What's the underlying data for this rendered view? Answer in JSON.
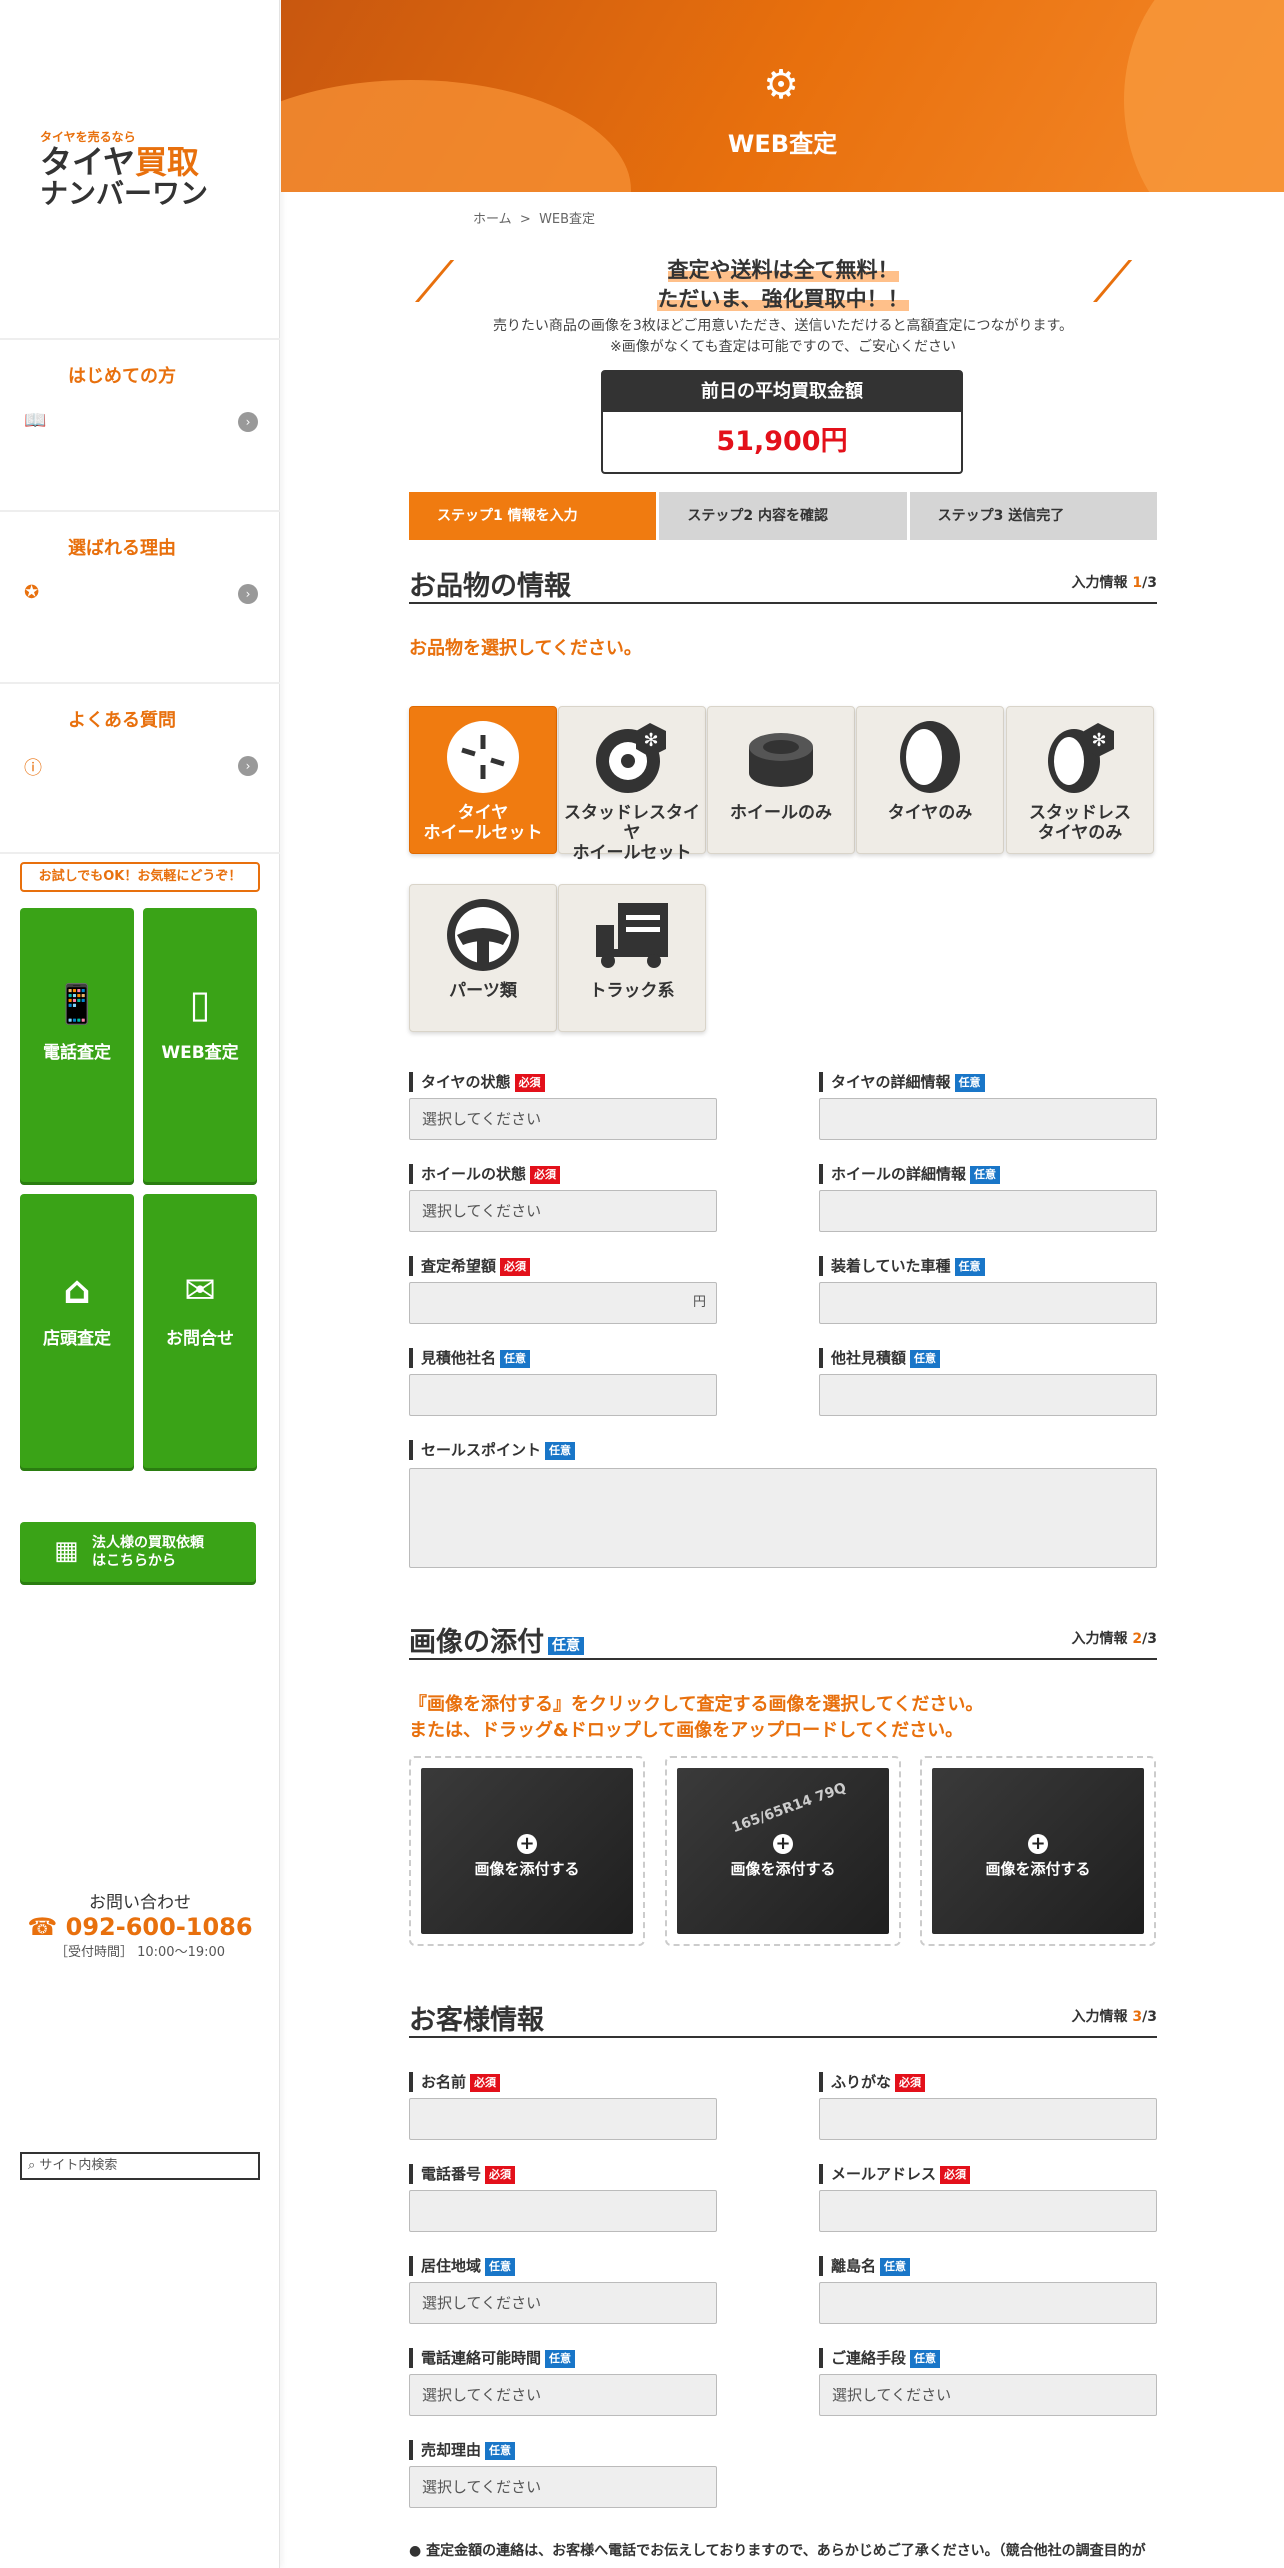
{
  "sidebar": {
    "logo": {
      "tagline": "タイヤを売るなら",
      "line1a": "タイヤ",
      "line1b": "買取",
      "line2": "ナンバーワン"
    },
    "nav": [
      {
        "label": "はじめての方",
        "icon": "book-icon"
      },
      {
        "label": "選ばれる理由",
        "icon": "badge-icon"
      },
      {
        "label": "よくある質問",
        "icon": "question-icon"
      }
    ],
    "speech": "お試しでもOK！お気軽にどうぞ！",
    "buttons": [
      {
        "label": "電話査定",
        "icon": "phone-icon"
      },
      {
        "label": "WEB査定",
        "icon": "tablet-icon"
      },
      {
        "label": "店頭査定",
        "icon": "store-icon"
      },
      {
        "label": "お問合せ",
        "icon": "mail-icon"
      }
    ],
    "corporate": {
      "line1": "法人様の買取依頼",
      "line2": "はこちらから"
    },
    "contact": {
      "label": "お問い合わせ",
      "phone": "☎ 092-600-1086",
      "hours": "［受付時間］ 10:00〜19:00"
    },
    "search_placeholder": "サイト内検索"
  },
  "hero": {
    "title": "WEB査定"
  },
  "breadcrumb": {
    "home": "ホーム",
    "sep": ">",
    "current": "WEB査定"
  },
  "promo": {
    "line1": "査定や送料は全て無料！",
    "line2": "ただいま、強化買取中！！",
    "line3": "売りたい商品の画像を3枚ほどご用意いただき、送信いただけると高額査定につながります。",
    "line4": "※画像がなくても査定は可能ですので、ご安心ください"
  },
  "average": {
    "label": "前日の平均買取金額",
    "value": "51,900円"
  },
  "steps": [
    {
      "label": "ステップ1 情報を入力",
      "active": true
    },
    {
      "label": "ステップ2 内容を確認",
      "active": false
    },
    {
      "label": "ステップ3 送信完了",
      "active": false
    }
  ],
  "product_section": {
    "title": "お品物の情報",
    "counter_prefix": "入力情報 ",
    "counter_num": "1",
    "counter_total": "/3",
    "instruction": "お品物を選択してください。",
    "categories": [
      {
        "line1": "タイヤ",
        "line2": "ホイールセット",
        "icon": "tire-wheel-icon",
        "active": true
      },
      {
        "line1": "スタッドレスタイヤ",
        "line2": "ホイールセット",
        "icon": "studless-wheel-icon",
        "active": false
      },
      {
        "line1": "ホイールのみ",
        "line2": "",
        "icon": "wheel-icon",
        "active": false
      },
      {
        "line1": "タイヤのみ",
        "line2": "",
        "icon": "tire-icon",
        "active": false
      },
      {
        "line1": "スタッドレス",
        "line2": "タイヤのみ",
        "icon": "studless-tire-icon",
        "active": false
      },
      {
        "line1": "パーツ類",
        "line2": "",
        "icon": "steering-wheel-icon",
        "active": false
      },
      {
        "line1": "トラック系",
        "line2": "",
        "icon": "truck-icon",
        "active": false
      }
    ],
    "fields": [
      {
        "label": "タイヤの状態",
        "badge": "必須",
        "value": "選択してください"
      },
      {
        "label": "タイヤの詳細情報",
        "badge": "任意",
        "value": ""
      },
      {
        "label": "ホイールの状態",
        "badge": "必須",
        "value": "選択してください"
      },
      {
        "label": "ホイールの詳細情報",
        "badge": "任意",
        "value": ""
      },
      {
        "label": "査定希望額",
        "badge": "必須",
        "value": "",
        "unit": "円"
      },
      {
        "label": "装着していた車種",
        "badge": "任意",
        "value": ""
      },
      {
        "label": "見積他社名",
        "badge": "任意",
        "value": ""
      },
      {
        "label": "他社見積額",
        "badge": "任意",
        "value": ""
      },
      {
        "label": "セールスポイント",
        "badge": "任意",
        "value": ""
      }
    ]
  },
  "image_section": {
    "title": "画像の添付",
    "badge": "任意",
    "counter_prefix": "入力情報 ",
    "counter_num": "2",
    "counter_total": "/3",
    "instruction1": "『画像を添付する』をクリックして査定する画像を選択してください。",
    "instruction2": "または、ドラッグ&ドロップして画像をアップロードしてください。",
    "upload_label": "画像を添付する",
    "photo_text": "165/65R14 79Q"
  },
  "customer_section": {
    "title": "お客様情報",
    "counter_prefix": "入力情報 ",
    "counter_num": "3",
    "counter_total": "/3",
    "fields": [
      {
        "label": "お名前",
        "badge": "必須",
        "value": ""
      },
      {
        "label": "ふりがな",
        "badge": "必須",
        "value": ""
      },
      {
        "label": "電話番号",
        "badge": "必須",
        "value": ""
      },
      {
        "label": "メールアドレス",
        "badge": "必須",
        "value": ""
      },
      {
        "label": "居住地域",
        "badge": "任意",
        "value": "選択してください"
      },
      {
        "label": "離島名",
        "badge": "任意",
        "value": ""
      },
      {
        "label": "電話連絡可能時間",
        "badge": "任意",
        "value": "選択してください"
      },
      {
        "label": "ご連絡手段",
        "badge": "任意",
        "value": "選択してください"
      },
      {
        "label": "売却理由",
        "badge": "任意",
        "value": "選択してください"
      }
    ]
  },
  "footnote": "● 査定金額の連絡は、お客様へ電話でお伝えしておりますので、あらかじめご了承ください。（競合他社の調査目的が"
}
